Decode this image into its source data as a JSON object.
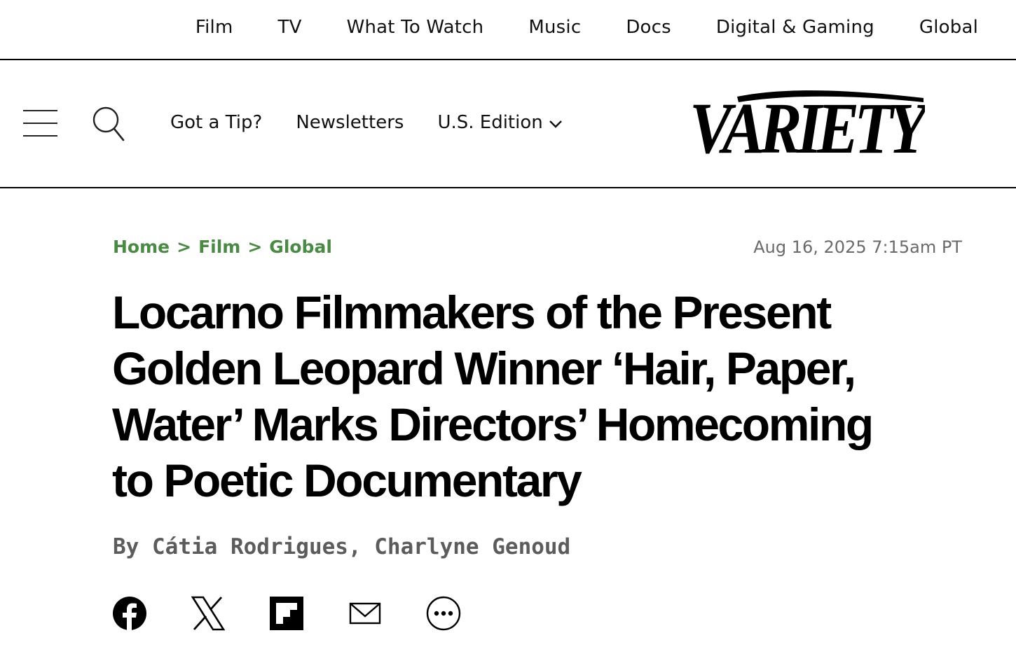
{
  "topnav": {
    "items": [
      "Film",
      "TV",
      "What To Watch",
      "Music",
      "Docs",
      "Digital & Gaming",
      "Global"
    ]
  },
  "header": {
    "tip_label": "Got a Tip?",
    "newsletters_label": "Newsletters",
    "edition_label": "U.S. Edition",
    "logo_text": "VARIETY"
  },
  "breadcrumb": {
    "items": [
      "Home",
      "Film",
      "Global"
    ],
    "separator": ">"
  },
  "article": {
    "timestamp": "Aug 16, 2025 7:15am PT",
    "headline_lines": [
      "Locarno Filmmakers of the Present",
      "Golden Leopard Winner ‘Hair, Paper,",
      "Water’ Marks Directors’ Homecoming",
      "to Poetic Documentary"
    ],
    "byline": "By Cátia Rodrigues, Charlyne Genoud"
  },
  "share": {
    "icons": [
      "facebook-icon",
      "x-icon",
      "flipboard-icon",
      "email-icon",
      "more-icon"
    ]
  },
  "colors": {
    "breadcrumb": "#4a8a44",
    "timestamp": "#6a6a6a",
    "byline": "#5c5c5c",
    "text": "#000000"
  }
}
